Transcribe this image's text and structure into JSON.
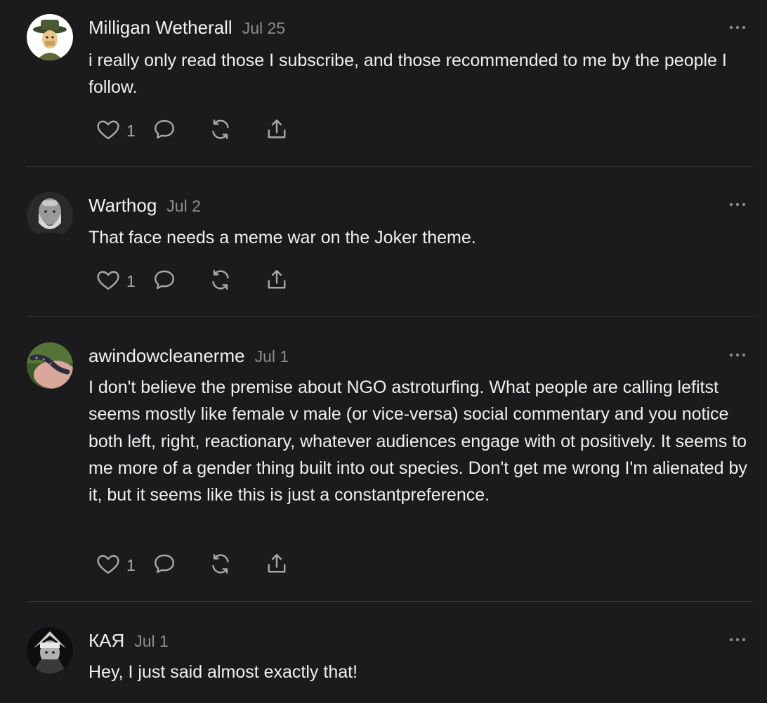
{
  "comments": [
    {
      "author": "Milligan Wetherall",
      "date": "Jul 25",
      "text": "i really only read those I subscribe, and those recommended to me by the people I follow.",
      "likes": "1",
      "avatar_icon": "cartoon-hat-man-avatar"
    },
    {
      "author": "Warthog",
      "date": "Jul 2",
      "text": "That face needs a meme war on the Joker theme.",
      "likes": "1",
      "avatar_icon": "bearded-man-photo-avatar"
    },
    {
      "author": "awindowcleanerme",
      "date": "Jul 1",
      "text": "I don't believe the premise about NGO astroturfing. What people are calling lefitst seems mostly like female v male (or vice-versa) social commentary and you notice both left, right, reactionary, whatever audiences engage with ot positively. It seems to me more of a gender thing built into out species. Don't get me wrong I'm alienated by it, but it seems like this is just a constantpreference.",
      "likes": "1",
      "avatar_icon": "salamander-photo-avatar"
    },
    {
      "author": "КАЯ",
      "date": "Jul 1",
      "text": "Hey, I just said almost exactly that!",
      "avatar_icon": "warrior-helmet-avatar"
    }
  ],
  "icons": {
    "like": "heart-icon",
    "reply": "comment-bubble-icon",
    "restack": "restack-arrows-icon",
    "share": "share-upload-icon",
    "more": "more-dots-icon"
  },
  "colors": {
    "background": "#1b1b1d",
    "text": "#f0f0f0",
    "muted": "#8c8c90",
    "divider": "#35353a"
  }
}
